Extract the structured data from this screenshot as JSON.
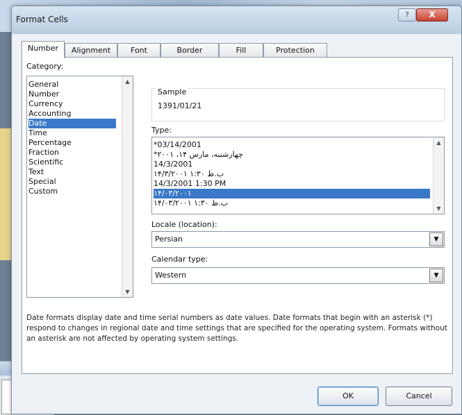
{
  "window": {
    "title": "Format Cells",
    "close_label": "X",
    "help_label": "?"
  },
  "tabs": [
    "Number",
    "Alignment",
    "Font",
    "Border",
    "Fill",
    "Protection"
  ],
  "category": {
    "label": "Category:",
    "items": [
      "General",
      "Number",
      "Currency",
      "Accounting",
      "Date",
      "Time",
      "Percentage",
      "Fraction",
      "Scientific",
      "Text",
      "Special",
      "Custom"
    ],
    "selected": "Date"
  },
  "sample": {
    "label": "Sample",
    "value": "1391/01/21"
  },
  "type": {
    "label": "Type:",
    "items": [
      "*03/14/2001",
      "*چهارشنبه، مارس ۱۴، ۲۰۰۱",
      "14/3/2001",
      "۱۴/۳/۲۰۰۱ ۱:۳۰ ب.ظ",
      "14/3/2001 1:30 PM",
      "۱۴/۰۳/۲۰۰۱",
      "۱۴/۰۳/۲۰۰۱ ۱:۳۰ ب.ظ"
    ],
    "selected_index": 5
  },
  "locale": {
    "label": "Locale (location):",
    "value": "Persian"
  },
  "calendar": {
    "label": "Calendar type:",
    "value": "Western"
  },
  "description": "Date formats display date and time serial numbers as date values.  Date formats that begin with an asterisk (*) respond to changes in regional date and time settings that are specified for the operating system. Formats without an asterisk are not affected by operating system settings.",
  "buttons": {
    "ok": "OK",
    "cancel": "Cancel"
  },
  "colors": {
    "selection": "#3a78c9",
    "close": "#c74335"
  }
}
